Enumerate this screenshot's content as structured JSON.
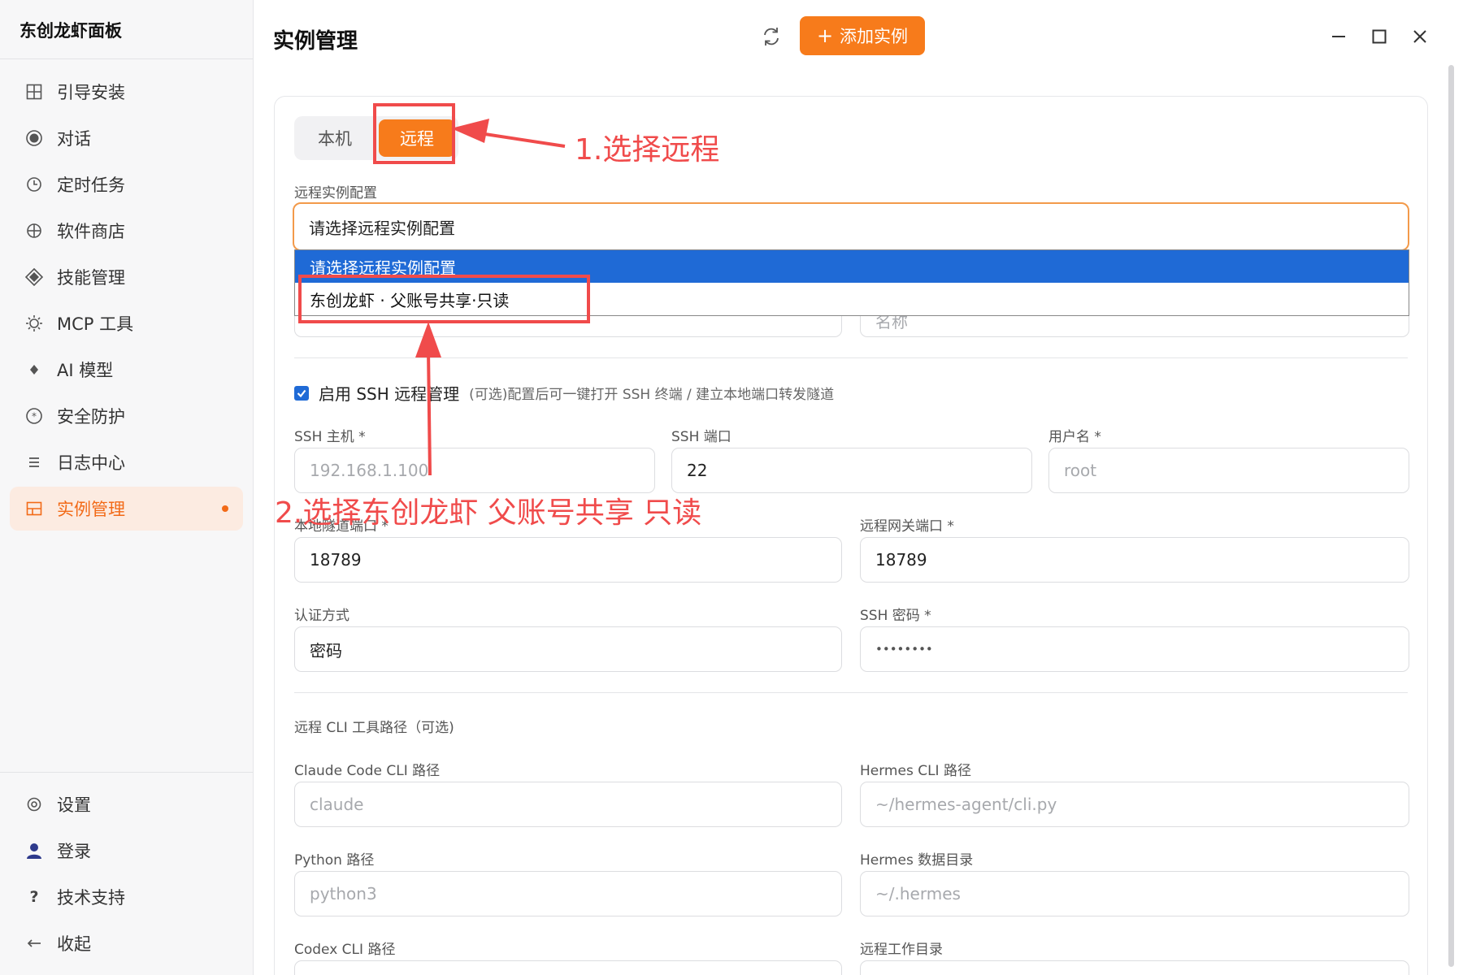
{
  "app": {
    "brand": "东创龙虾面板"
  },
  "sidebar": {
    "items": [
      {
        "label": "引导安装",
        "icon": "grid-icon"
      },
      {
        "label": "对话",
        "icon": "radio-icon"
      },
      {
        "label": "定时任务",
        "icon": "clock-icon"
      },
      {
        "label": "软件商店",
        "icon": "globe-icon"
      },
      {
        "label": "技能管理",
        "icon": "diamond-icon"
      },
      {
        "label": "MCP 工具",
        "icon": "sun-icon"
      },
      {
        "label": "AI 模型",
        "icon": "spark-icon"
      },
      {
        "label": "安全防护",
        "icon": "shield-icon"
      },
      {
        "label": "日志中心",
        "icon": "list-icon"
      },
      {
        "label": "实例管理",
        "icon": "panel-icon",
        "active": true
      }
    ],
    "bottom": [
      {
        "label": "设置",
        "icon": "gear-icon"
      },
      {
        "label": "登录",
        "icon": "user-icon"
      },
      {
        "label": "技术支持",
        "icon": "question-icon"
      },
      {
        "label": "收起",
        "icon": "arrow-left-icon"
      }
    ]
  },
  "header": {
    "title": "实例管理",
    "add_button": "添加实例"
  },
  "colors": {
    "accent": "#f77b1b",
    "active_bg": "#fcebe1",
    "select_blue": "#1f6ad6",
    "annotation": "#f04b4b"
  },
  "tabs": {
    "local": "本机",
    "remote": "远程"
  },
  "remote_config": {
    "label": "远程实例配置",
    "selected": "请选择远程实例配置",
    "options": [
      "请选择远程实例配置",
      "东创龙虾 · 父账号共享·只读"
    ],
    "hidden_name_placeholder": "名称"
  },
  "ssh": {
    "enable_label": "启用 SSH 远程管理",
    "enable_desc": "(可选)配置后可一键打开 SSH 终端 / 建立本地端口转发隧道",
    "host_label": "SSH 主机 *",
    "host_placeholder": "192.168.1.100",
    "port_label": "SSH 端口",
    "port_value": "22",
    "user_label": "用户名 *",
    "user_placeholder": "root",
    "local_tunnel_label": "本地隧道端口 *",
    "local_tunnel_value": "18789",
    "gateway_label": "远程网关端口 *",
    "gateway_value": "18789",
    "auth_label": "认证方式",
    "auth_value": "密码",
    "password_label": "SSH 密码 *",
    "password_value": "••••••••"
  },
  "cli": {
    "section_title": "远程 CLI 工具路径（可选)",
    "claude_label": "Claude Code CLI 路径",
    "claude_placeholder": "claude",
    "hermes_label": "Hermes CLI 路径",
    "hermes_placeholder": "~/hermes-agent/cli.py",
    "python_label": "Python 路径",
    "python_placeholder": "python3",
    "hermes_data_label": "Hermes 数据目录",
    "hermes_data_placeholder": "~/.hermes",
    "codex_label": "Codex CLI 路径",
    "workdir_label": "远程工作目录"
  },
  "annotations": {
    "step1": "1.选择远程",
    "step2": "2.选择东创龙虾 父账号共享 只读"
  }
}
